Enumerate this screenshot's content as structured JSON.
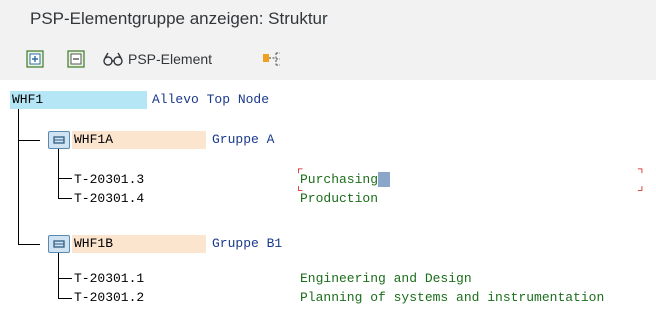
{
  "window": {
    "title": "PSP-Elementgruppe anzeigen: Struktur"
  },
  "toolbar": {
    "expand_icon": "expand-subtree-icon",
    "collapse_icon": "collapse-subtree-icon",
    "psp_label": "PSP-Element",
    "psp_icon": "glasses-icon",
    "structure_icon": "hierarchy-icon"
  },
  "tree": {
    "root": {
      "key": "WHF1",
      "desc": "Allevo Top Node"
    },
    "groups": [
      {
        "key": "WHF1A",
        "desc": "Gruppe A",
        "children": [
          {
            "key": "T-20301.3",
            "desc": "Purchasing"
          },
          {
            "key": "T-20301.4",
            "desc": "Production"
          }
        ]
      },
      {
        "key": "WHF1B",
        "desc": "Gruppe B1",
        "children": [
          {
            "key": "T-20301.1",
            "desc": "Engineering and Design"
          },
          {
            "key": "T-20301.2",
            "desc": "Planning of systems and instrumentation"
          }
        ]
      }
    ]
  },
  "colors": {
    "root_highlight": "#b5e6f6",
    "group_highlight": "#fbe5cf",
    "child_highlight": "#ffffff",
    "desc_blue": "#1a3a8a",
    "desc_green": "#1b6e1b"
  }
}
